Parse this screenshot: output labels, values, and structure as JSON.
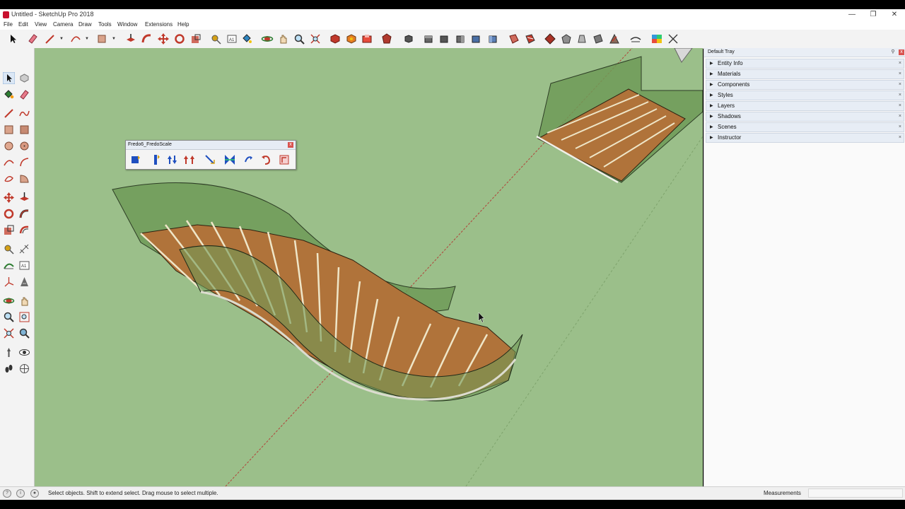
{
  "window": {
    "title": "Untitled - SketchUp Pro 2018",
    "controls": {
      "minimize": "—",
      "restore": "❐",
      "close": "✕"
    }
  },
  "menu": [
    "File",
    "Edit",
    "View",
    "Camera",
    "Draw",
    "Tools",
    "Window",
    "Extensions",
    "Help"
  ],
  "main_toolbar": {
    "icons": [
      "select-icon",
      "eraser-icon",
      "line-icon",
      "arc-icon",
      "rectangle-icon",
      "push-pull-icon",
      "follow-me-icon",
      "move-icon",
      "rotate-icon",
      "scale-icon",
      "tape-measure-icon",
      "text-icon",
      "paint-bucket-icon",
      "orbit-icon",
      "pan-icon",
      "zoom-icon",
      "zoom-extents-icon",
      "component-icon-a",
      "component-icon-b",
      "component-icon-c",
      "warehouse-icon",
      "iso-view-icon",
      "top-view-icon",
      "front-view-icon",
      "right-view-icon",
      "back-view-icon",
      "left-view-icon",
      "section-icon-a",
      "section-icon-b",
      "solid-icon-a",
      "solid-icon-b",
      "solid-icon-c",
      "solid-icon-d",
      "solid-icon-e",
      "sandbox-icon",
      "color-swatch-icon",
      "axes-icon"
    ]
  },
  "fredo_toolbar": {
    "title": "Fredo6_FredoScale",
    "close": "x",
    "icons": [
      "box-scale-icon",
      "box-stretch-icon",
      "tapering-icon",
      "planar-shear-icon",
      "twisting-icon",
      "radial-bend-icon",
      "bend-icon",
      "rotate-icon",
      "undo-icon",
      "settings-icon"
    ]
  },
  "tray": {
    "title": "Default Tray",
    "pin": "⚲",
    "close": "x",
    "panels": [
      "Entity Info",
      "Materials",
      "Components",
      "Styles",
      "Layers",
      "Shadows",
      "Scenes",
      "Instructor"
    ]
  },
  "status": {
    "hint": "Select objects. Shift to extend select. Drag mouse to select multiple.",
    "measurements_label": "Measurements",
    "measurements_value": ""
  },
  "colors": {
    "viewport_bg": "#9bbf8a",
    "stringer": "#6f9a57",
    "wood_light": "#c98b4a",
    "wood_dark": "#8c5422",
    "axis_red": "#b0443a"
  }
}
